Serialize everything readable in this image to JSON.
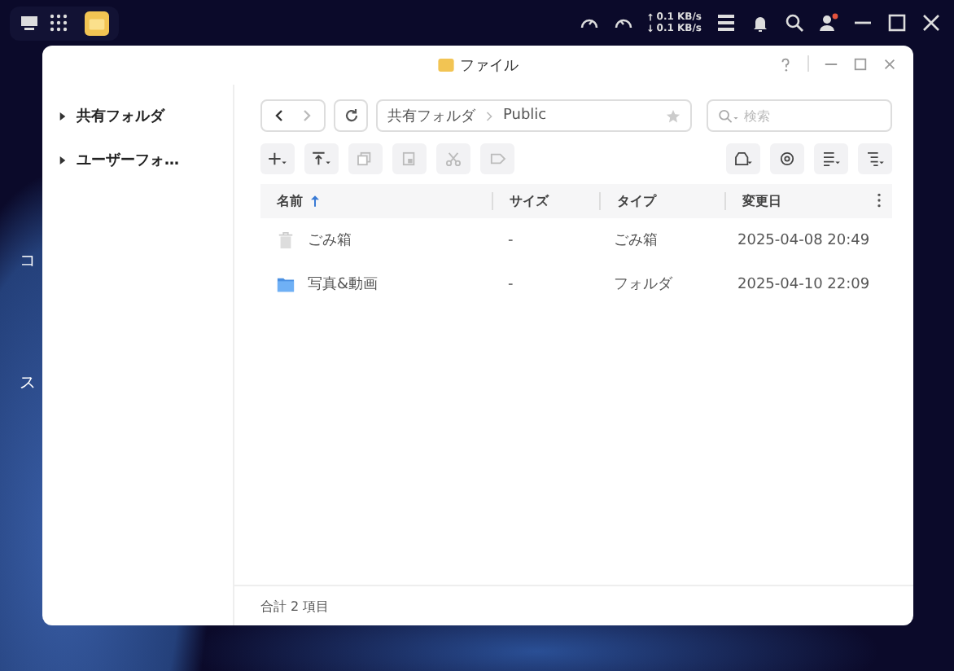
{
  "taskbar": {
    "upload": "0.1 KB/s",
    "download": "0.1 KB/s"
  },
  "desktop_labels": [
    "コ",
    "ス"
  ],
  "window": {
    "title": "ファイル"
  },
  "sidebar": {
    "items": [
      {
        "label": "共有フォルダ",
        "expanded": false
      },
      {
        "label": "ユーザーフォ…",
        "expanded": false
      }
    ]
  },
  "path": [
    "共有フォルダ",
    "Public"
  ],
  "search": {
    "placeholder": "検索"
  },
  "table": {
    "columns": [
      {
        "label": "名前",
        "sorted": true
      },
      {
        "label": "サイズ",
        "sorted": false
      },
      {
        "label": "タイプ",
        "sorted": false
      },
      {
        "label": "変更日",
        "sorted": false
      }
    ],
    "rows": [
      {
        "kind": "trash",
        "name": "ごみ箱",
        "size": "-",
        "type": "ごみ箱",
        "modified": "2025-04-08 20:49"
      },
      {
        "kind": "folder",
        "name": "写真&動画",
        "size": "-",
        "type": "フォルダ",
        "modified": "2025-04-10 22:09"
      }
    ]
  },
  "status_bar": "合計 2 項目"
}
